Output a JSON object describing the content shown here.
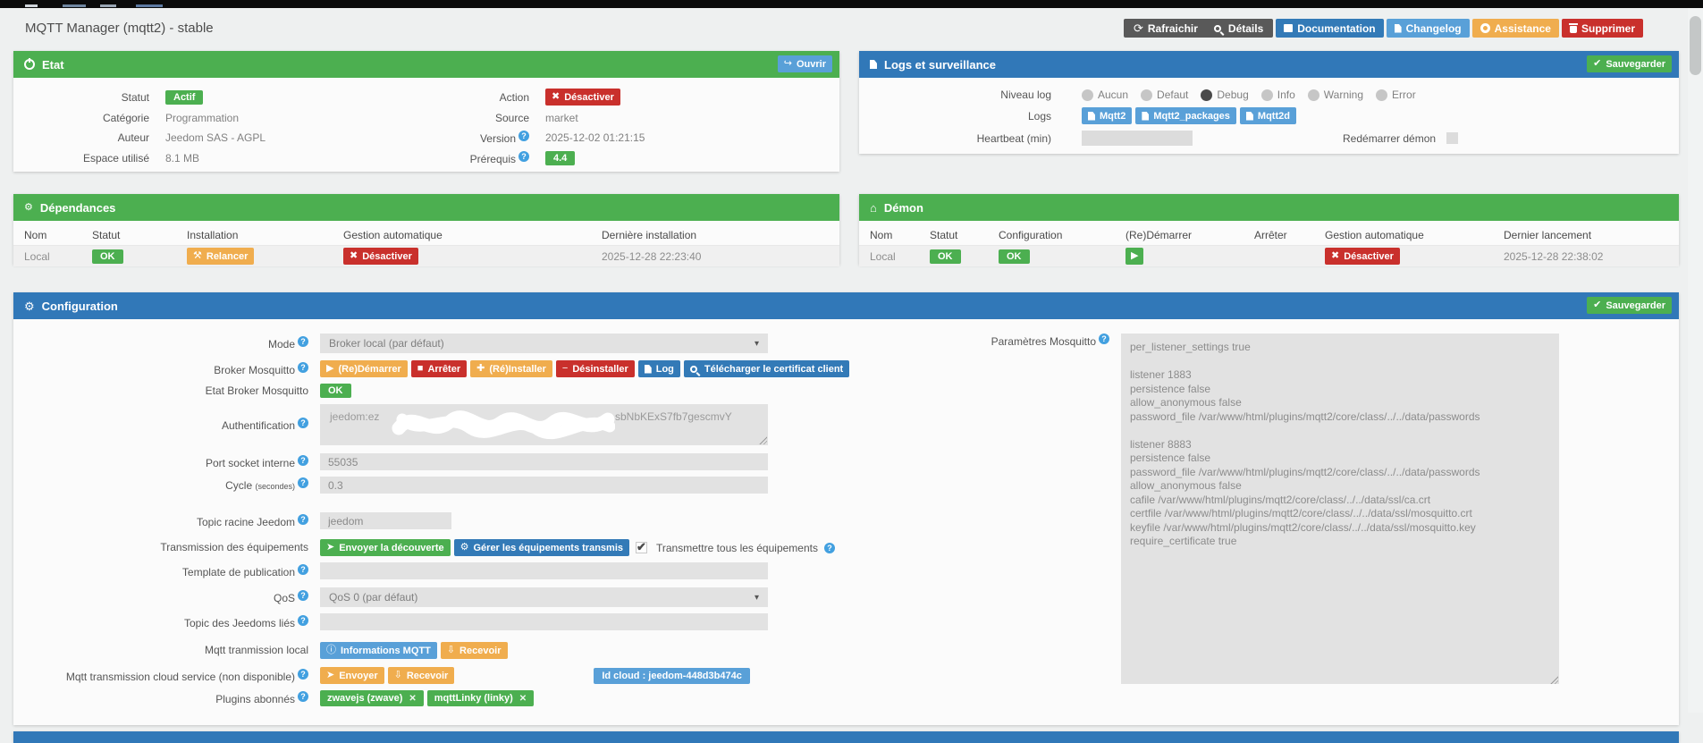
{
  "colors": {
    "header_green": "#4caf50",
    "header_blue": "#3178b8",
    "orange": "#f0ad4e",
    "red": "#c9302c",
    "light_blue": "#59a0d8",
    "steel_blue": "#337ab7",
    "dark_gray": "#595959"
  },
  "icons": {
    "refresh": "⟳",
    "open_arrow": "↪",
    "cog": "⚙",
    "building": "⌂",
    "check": "✔",
    "cross": "✖",
    "play": "▶",
    "stop": "■",
    "plus": "✚",
    "minus": "−",
    "info": "ⓘ",
    "send": "➤",
    "download": "⇩",
    "tools": "⚒",
    "remove": "✕",
    "caret": "▾",
    "question": "?"
  },
  "page": {
    "title": "MQTT Manager (mqtt2) - stable"
  },
  "toolbar": {
    "refresh": "Rafraichir",
    "details": "Détails",
    "documentation": "Documentation",
    "changelog": "Changelog",
    "assistance": "Assistance",
    "delete": "Supprimer"
  },
  "etat": {
    "title": "Etat",
    "open": "Ouvrir",
    "statut": {
      "label": "Statut",
      "value": "Actif"
    },
    "categorie": {
      "label": "Catégorie",
      "value": "Programmation"
    },
    "auteur": {
      "label": "Auteur",
      "value": "Jeedom SAS - AGPL"
    },
    "espace": {
      "label": "Espace utilisé",
      "value": "8.1 MB"
    },
    "action": {
      "label": "Action",
      "value": "Désactiver"
    },
    "source": {
      "label": "Source",
      "value": "market"
    },
    "version": {
      "label": "Version",
      "value": "2025-12-02 01:21:15"
    },
    "prerequis": {
      "label": "Prérequis",
      "value": "4.4"
    }
  },
  "logs": {
    "title": "Logs et surveillance",
    "save": "Sauvegarder",
    "niveau_label": "Niveau log",
    "levels": [
      "Aucun",
      "Defaut",
      "Debug",
      "Info",
      "Warning",
      "Error"
    ],
    "selected_level": "Debug",
    "logs_label": "Logs",
    "log_files": [
      "Mqtt2",
      "Mqtt2_packages",
      "Mqtt2d"
    ],
    "heartbeat_label": "Heartbeat (min)",
    "heartbeat_value": "",
    "restart_daemon_label": "Redémarrer démon"
  },
  "dependances": {
    "title": "Dépendances",
    "headers": [
      "Nom",
      "Statut",
      "Installation",
      "Gestion automatique",
      "Dernière installation"
    ],
    "row": {
      "nom": "Local",
      "statut": "OK",
      "installation": "Relancer",
      "gestion": "Désactiver",
      "date": "2025-12-28 22:23:40"
    }
  },
  "demon": {
    "title": "Démon",
    "headers": [
      "Nom",
      "Statut",
      "Configuration",
      "(Re)Démarrer",
      "Arrêter",
      "Gestion automatique",
      "Dernier lancement"
    ],
    "row": {
      "nom": "Local",
      "statut": "OK",
      "configuration": "OK",
      "gestion": "Désactiver",
      "date": "2025-12-28 22:38:02"
    }
  },
  "config": {
    "title": "Configuration",
    "save": "Sauvegarder",
    "mode": {
      "label": "Mode",
      "value": "Broker local (par défaut)"
    },
    "broker": {
      "label": "Broker Mosquitto",
      "restart": "(Re)Démarrer",
      "stop": "Arrêter",
      "reinstall": "(Ré)Installer",
      "uninstall": "Désinstaller",
      "log": "Log",
      "cert": "Télécharger le certificat client"
    },
    "etat_broker": {
      "label": "Etat Broker Mosquitto",
      "value": "OK"
    },
    "auth": {
      "label": "Authentification",
      "value_start": "jeedom:ez",
      "value_end": "sbNbKExS7fb7gescmvY"
    },
    "port": {
      "label": "Port socket interne",
      "value": "55035"
    },
    "cycle": {
      "label": "Cycle",
      "unit": "(secondes)",
      "value": "0.3"
    },
    "topic": {
      "label": "Topic racine Jeedom",
      "value": "jeedom"
    },
    "transmission": {
      "label": "Transmission des équipements",
      "discovery": "Envoyer la découverte",
      "manage": "Gérer les équipements transmis",
      "all": "Transmettre tous les équipements"
    },
    "template": {
      "label": "Template de publication",
      "value": ""
    },
    "qos": {
      "label": "QoS",
      "value": "QoS 0 (par défaut)"
    },
    "linked": {
      "label": "Topic des Jeedoms liés",
      "value": ""
    },
    "local": {
      "label": "Mqtt tranmission local",
      "info": "Informations MQTT",
      "receive": "Recevoir"
    },
    "cloud": {
      "label": "Mqtt transmission cloud service (non disponible)",
      "send": "Envoyer",
      "receive": "Recevoir",
      "id": "Id cloud : jeedom-448d3b474c"
    },
    "plugins": {
      "label": "Plugins abonnés",
      "items": [
        "zwavejs (zwave)",
        "mqttLinky (linky)"
      ]
    },
    "params": {
      "label": "Paramètres Mosquitto",
      "value": "per_listener_settings true\n\nlistener 1883\npersistence false\nallow_anonymous false\npassword_file /var/www/html/plugins/mqtt2/core/class/../../data/passwords\n\nlistener 8883\npersistence false\npassword_file /var/www/html/plugins/mqtt2/core/class/../../data/passwords\nallow_anonymous false\ncafile /var/www/html/plugins/mqtt2/core/class/../../data/ssl/ca.crt\ncertfile /var/www/html/plugins/mqtt2/core/class/../../data/ssl/mosquitto.crt\nkeyfile /var/www/html/plugins/mqtt2/core/class/../../data/ssl/mosquitto.key\nrequire_certificate true"
    }
  }
}
